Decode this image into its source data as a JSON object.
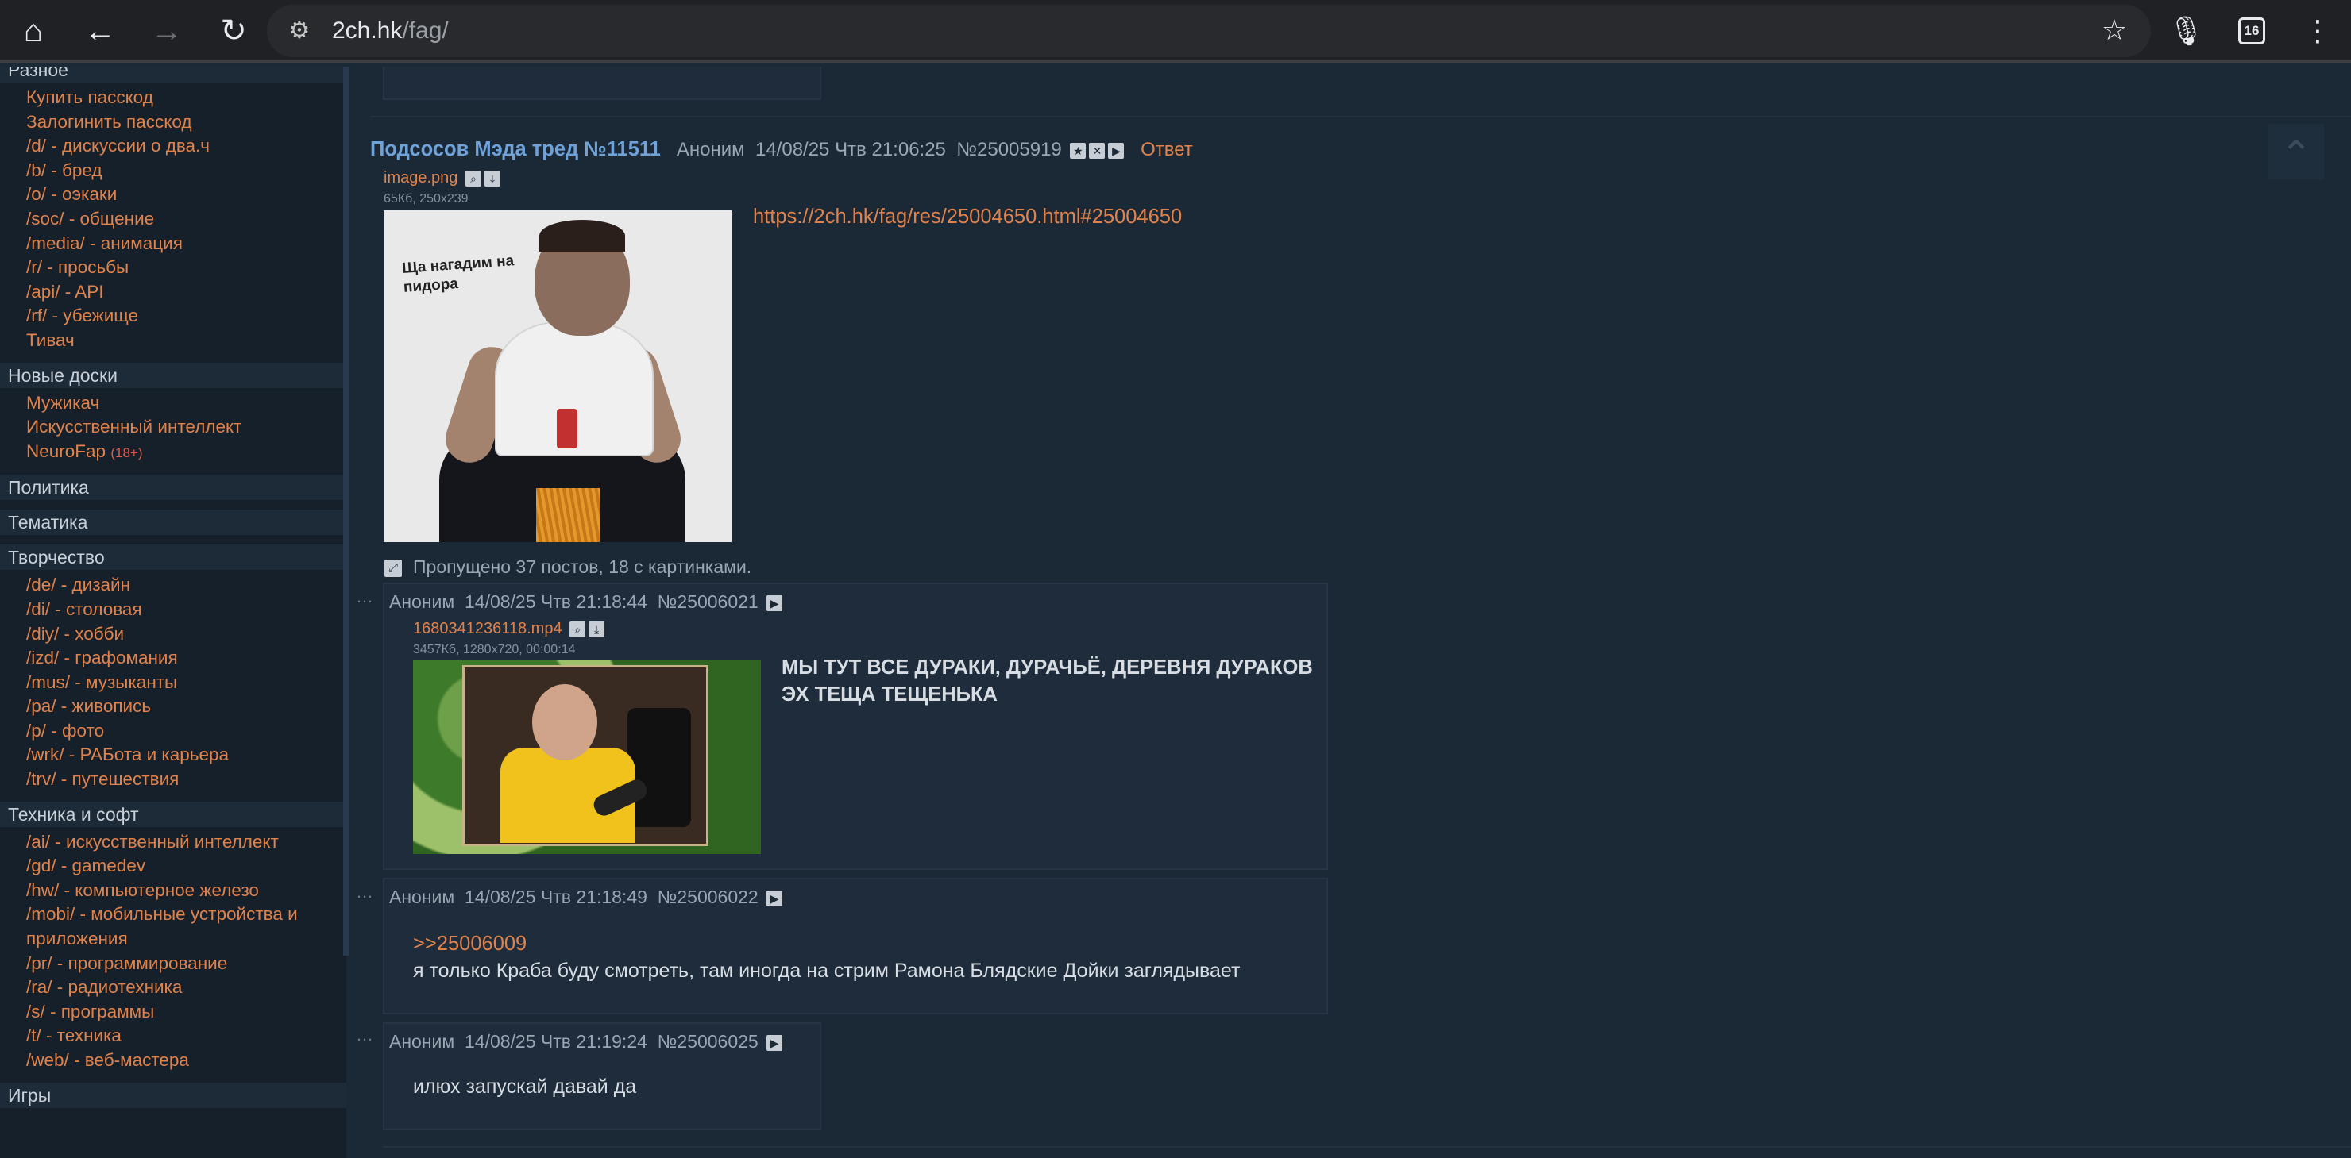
{
  "browser": {
    "url_host": "2ch.hk",
    "url_path": "/fag/",
    "tab_count": "16"
  },
  "sidebar": {
    "sections": [
      {
        "title": "Разное",
        "items": [
          {
            "label": "Купить пасскод"
          },
          {
            "label": "Залогинить пасскод"
          },
          {
            "label": "/d/ - дискуссии о два.ч"
          },
          {
            "label": "/b/ - бред"
          },
          {
            "label": "/o/ - оэкаки"
          },
          {
            "label": "/soc/ - общение"
          },
          {
            "label": "/media/ - анимация"
          },
          {
            "label": "/r/ - просьбы"
          },
          {
            "label": "/api/ - API"
          },
          {
            "label": "/rf/ - убежище"
          },
          {
            "label": "Тивач"
          }
        ]
      },
      {
        "title": "Новые доски",
        "items": [
          {
            "label": "Мужикач"
          },
          {
            "label": "Искусственный интеллект"
          },
          {
            "label": "NeuroFap",
            "tag": "(18+)"
          }
        ]
      },
      {
        "title": "Политика",
        "items": []
      },
      {
        "title": "Тематика",
        "items": []
      },
      {
        "title": "Творчество",
        "items": [
          {
            "label": "/de/ - дизайн"
          },
          {
            "label": "/di/ - столовая"
          },
          {
            "label": "/diy/ - хобби"
          },
          {
            "label": "/izd/ - графомания"
          },
          {
            "label": "/mus/ - музыканты"
          },
          {
            "label": "/pa/ - живопись"
          },
          {
            "label": "/p/ - фото"
          },
          {
            "label": "/wrk/ - РАБота и карьера"
          },
          {
            "label": "/trv/ - путешествия"
          }
        ]
      },
      {
        "title": "Техника и софт",
        "items": [
          {
            "label": "/ai/ - искусственный интеллект"
          },
          {
            "label": "/gd/ - gamedev"
          },
          {
            "label": "/hw/ - компьютерное железо"
          },
          {
            "label": "/mobi/ - мобильные устройства и приложения"
          },
          {
            "label": "/pr/ - программирование"
          },
          {
            "label": "/ra/ - радиотехника"
          },
          {
            "label": "/s/ - программы"
          },
          {
            "label": "/t/ - техника"
          },
          {
            "label": "/web/ - веб-мастера"
          }
        ]
      },
      {
        "title": "Игры",
        "items": []
      }
    ]
  },
  "thread": {
    "title": "Подсосов Мэда тред №11511",
    "author": "Аноним",
    "date": "14/08/25 Чтв 21:06:25",
    "number": "№25005919",
    "reply_label": "Ответ",
    "file_name": "image.png",
    "file_meta": "65Кб, 250x239",
    "image_caption": "Ща нагадим на пидора",
    "link": "https://2ch.hk/fag/res/25004650.html#25004650",
    "skipped_text": "Пропущено 37 постов, 18 с картинками."
  },
  "posts": [
    {
      "author": "Аноним",
      "date": "14/08/25 Чтв 21:18:44",
      "number": "№25006021",
      "file_name": "1680341236118.mp4",
      "file_meta": "3457Кб, 1280x720, 00:00:14",
      "lines": [
        "МЫ ТУТ ВСЕ ДУРАКИ, ДУРАЧЬЁ, ДЕРЕВНЯ ДУРАКОВ",
        "ЭХ ТЕЩА ТЕЩЕНЬКА"
      ]
    },
    {
      "author": "Аноним",
      "date": "14/08/25 Чтв 21:18:49",
      "number": "№25006022",
      "quote": ">>25006009",
      "text": "я только Краба буду смотреть, там иногда на стрим Рамона Блядские Дойки заглядывает"
    },
    {
      "author": "Аноним",
      "date": "14/08/25 Чтв 21:19:24",
      "number": "№25006025",
      "text": "илюх запускай давай да"
    }
  ]
}
